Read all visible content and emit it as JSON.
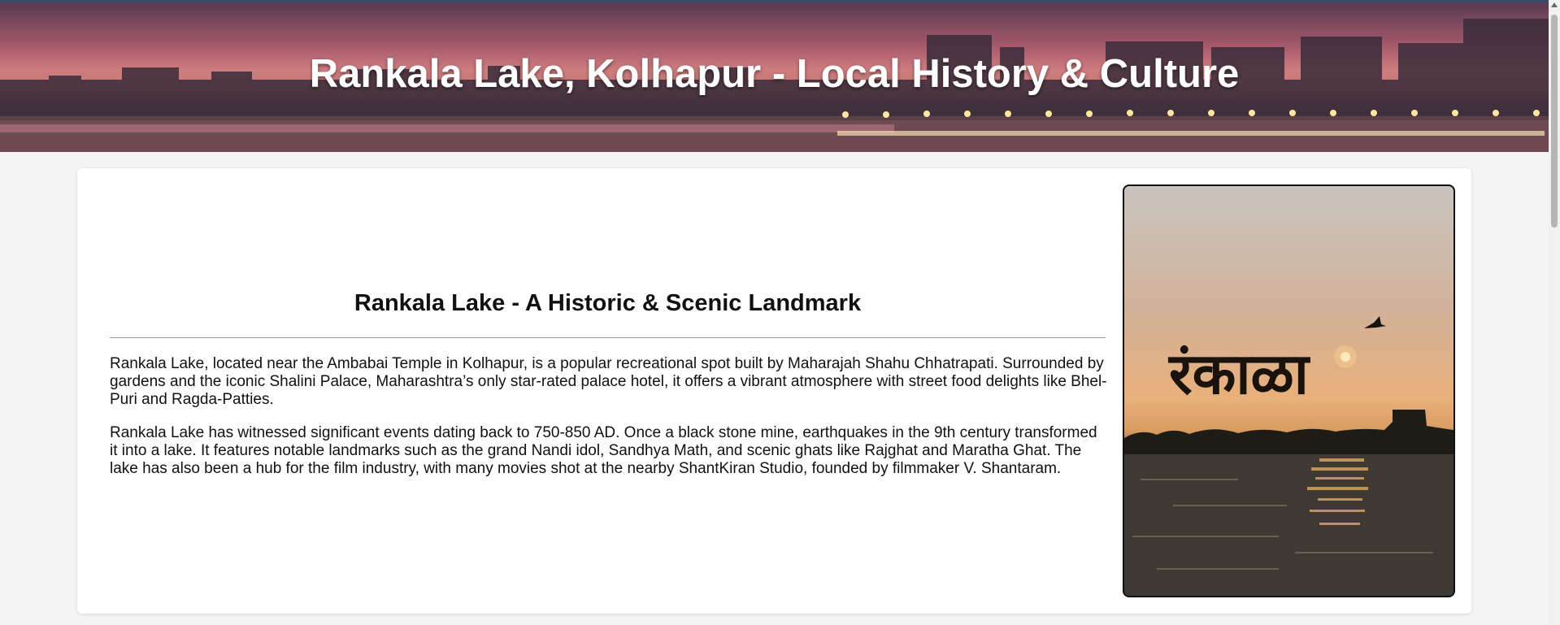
{
  "banner": {
    "title": "Rankala Lake, Kolhapur - Local History & Culture"
  },
  "content": {
    "heading": "Rankala Lake - A Historic & Scenic Landmark",
    "paragraphs": [
      "Rankala Lake, located near the Ambabai Temple in Kolhapur, is a popular recreational spot built by Maharajah Shahu Chhatrapati. Surrounded by gardens and the iconic Shalini Palace, Maharashtra’s only star-rated palace hotel, it offers a vibrant atmosphere with street food delights like Bhel-Puri and Ragda-Patties.",
      "Rankala Lake has witnessed significant events dating back to 750-850 AD. Once a black stone mine, earthquakes in the 9th century transformed it into a lake. It features notable landmarks such as the grand Nandi idol, Sandhya Math, and scenic ghats like Rajghat and Maratha Ghat. The lake has also been a hub for the film industry, with many movies shot at the nearby ShantKiran Studio, founded by filmmaker V. Shantaram."
    ]
  },
  "photo": {
    "marathi_text": "रंकाळा"
  },
  "colors": {
    "page_background": "#f4f4f4",
    "card_background": "#ffffff",
    "banner_text": "#ffffff",
    "body_text": "#111111"
  }
}
